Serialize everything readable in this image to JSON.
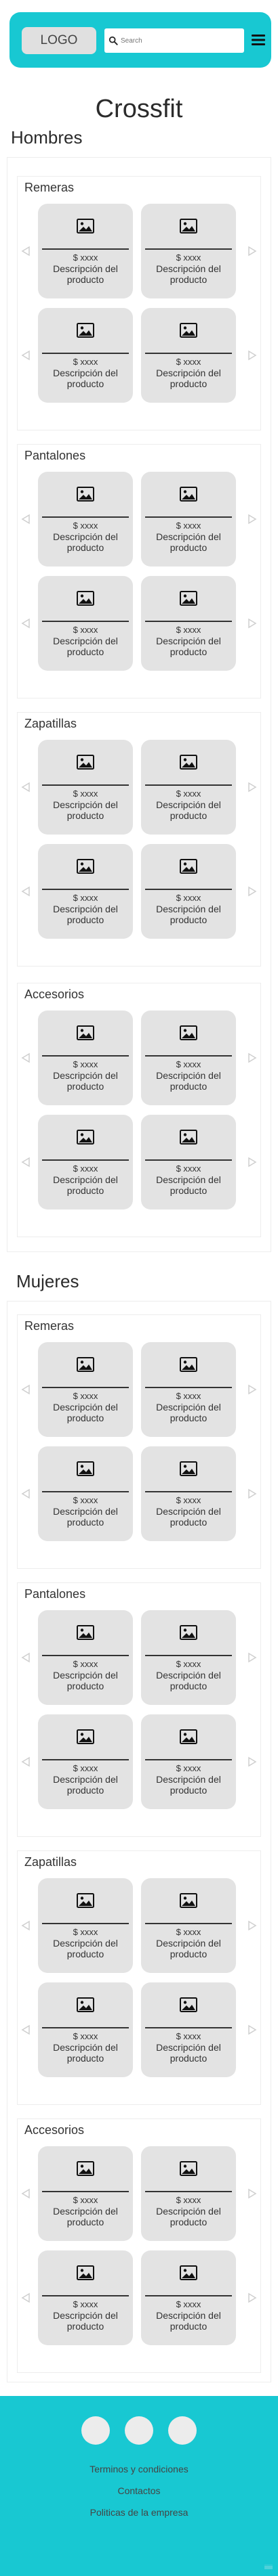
{
  "header": {
    "logo_label": "LOGO",
    "search_placeholder": "Search",
    "menu_icon": "hamburger-menu-icon"
  },
  "page_title": "Crossfit",
  "colors": {
    "brand": "#18c8d2",
    "card_bg": "#e3e3e3",
    "text": "#2b2b2b"
  },
  "product_card": {
    "image_icon": "image-placeholder-icon",
    "price": "$ xxxx",
    "description": "Descripción del producto"
  },
  "sections": [
    {
      "title": "Hombres",
      "categories": [
        {
          "title": "Remeras"
        },
        {
          "title": "Pantalones"
        },
        {
          "title": "Zapatillas"
        },
        {
          "title": "Accesorios"
        }
      ]
    },
    {
      "title": "Mujeres",
      "categories": [
        {
          "title": "Remeras"
        },
        {
          "title": "Pantalones"
        },
        {
          "title": "Zapatillas"
        },
        {
          "title": "Accesorios"
        }
      ]
    }
  ],
  "footer": {
    "social_icons": [
      "social-icon-1",
      "social-icon-2",
      "social-icon-3"
    ],
    "links": [
      "Terminos y condiciones",
      "Contactos",
      "Politicas de la empresa"
    ],
    "note": "iiiiii"
  }
}
